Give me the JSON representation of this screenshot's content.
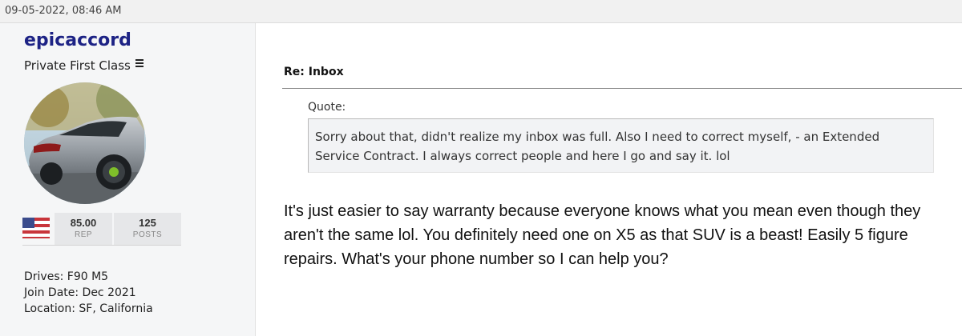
{
  "post": {
    "timestamp": "09-05-2022, 08:46 AM",
    "title": "Re: Inbox",
    "quote_label": "Quote:",
    "quote_text": "Sorry about that, didn't realize my inbox was full. Also I need to correct myself, - an Extended Service Contract. I always correct people and here I go and say it. lol",
    "body": "It's just easier to say warranty because everyone knows what you mean even though they aren't the same lol. You definitely need one on X5 as that SUV is a beast! Easily 5 figure repairs. What's your phone number so I can help you?"
  },
  "user": {
    "username": "epicaccord",
    "rank": "Private First Class",
    "rank_icon": "hamburger-icon",
    "avatar": "car-photo-avatar",
    "flag_icon": "us-flag-icon",
    "rep_value": "85.00",
    "rep_label": "REP",
    "posts_value": "125",
    "posts_label": "POSTS",
    "drives": "Drives: F90 M5",
    "join_date": "Join Date: Dec 2021",
    "location": "Location: SF, California"
  },
  "colors": {
    "username": "#1d2385",
    "sidebar_bg": "#f5f6f7",
    "quote_bg": "#f2f3f5"
  }
}
